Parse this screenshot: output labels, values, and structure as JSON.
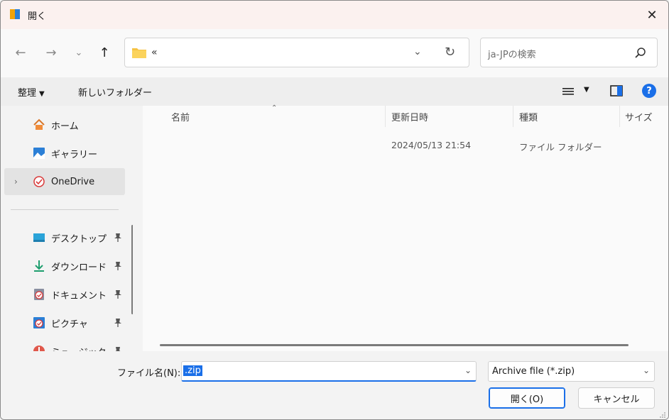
{
  "window": {
    "title": "開く",
    "close_icon": "close-icon"
  },
  "nav": {
    "back_icon": "back-arrow-icon",
    "forward_icon": "forward-arrow-icon",
    "recent_icon": "chevron-down-icon",
    "up_icon": "up-arrow-icon",
    "address_text": "«",
    "search_placeholder": "ja-JPの検索"
  },
  "command_bar": {
    "organize_label": "整理",
    "new_folder_label": "新しいフォルダー"
  },
  "sidebar": {
    "items": [
      {
        "label": "ホーム",
        "icon": "home-icon"
      },
      {
        "label": "ギャラリー",
        "icon": "gallery-icon"
      },
      {
        "label": "OneDrive",
        "icon": "onedrive-icon",
        "selected": true
      },
      {
        "label": "デスクトップ",
        "icon": "desktop-icon",
        "pinned": true
      },
      {
        "label": "ダウンロード",
        "icon": "download-icon",
        "pinned": true
      },
      {
        "label": "ドキュメント",
        "icon": "documents-icon",
        "pinned": true
      },
      {
        "label": "ピクチャ",
        "icon": "pictures-icon",
        "pinned": true
      },
      {
        "label": "ミュージック",
        "icon": "music-icon",
        "pinned": true
      }
    ]
  },
  "file_list": {
    "columns": [
      "名前",
      "更新日時",
      "種類",
      "サイズ"
    ],
    "rows": [
      {
        "name": "",
        "modified": "2024/05/13 21:54",
        "type": "ファイル フォルダー",
        "size": ""
      }
    ]
  },
  "bottom": {
    "filename_label": "ファイル名(N):",
    "filename_value": ".zip",
    "filetype_value": "Archive file (*.zip)",
    "open_button": "開く(O)",
    "cancel_button": "キャンセル"
  },
  "colors": {
    "accent": "#1a6fe8",
    "titlebar": "#fbf1ef"
  }
}
